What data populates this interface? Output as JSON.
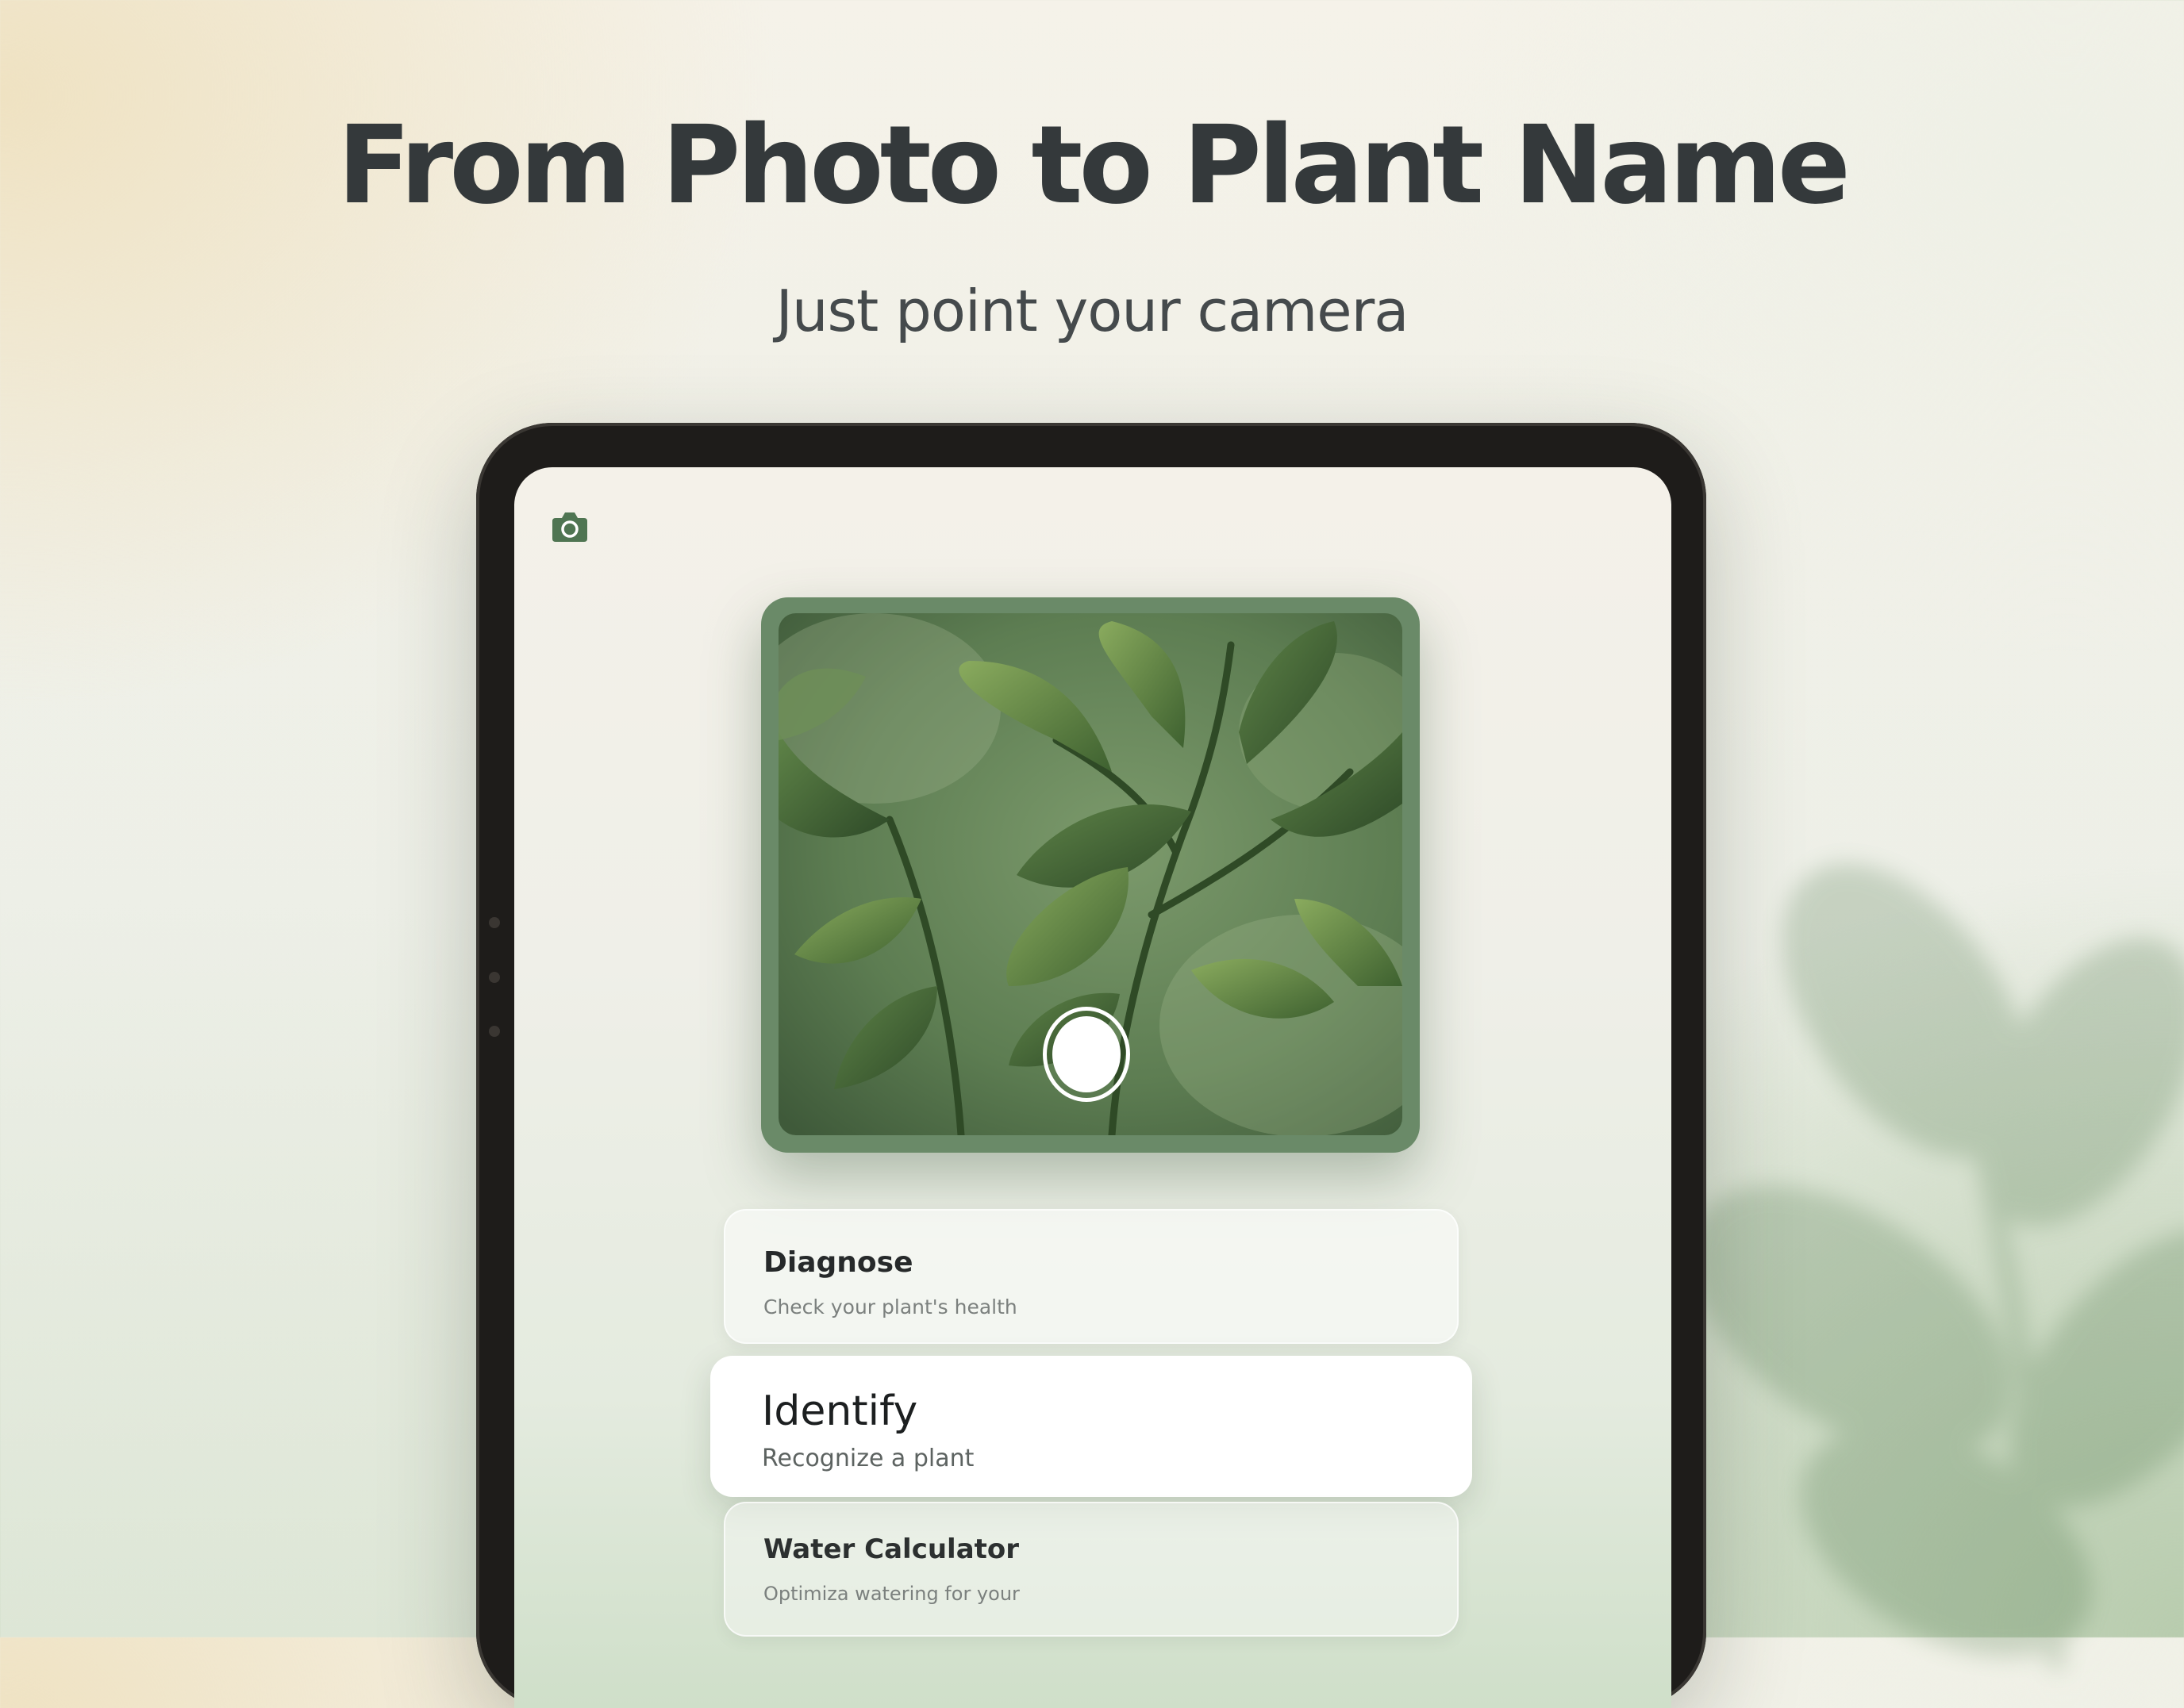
{
  "hero": {
    "title": "From Photo to Plant Name",
    "subtitle": "Just point your camera"
  },
  "app": {
    "top_icon": "camera-icon",
    "actions": [
      {
        "title": "Diagnose",
        "subtitle": "Check your plant's health"
      },
      {
        "title": "Identify",
        "subtitle": "Recognize a plant"
      },
      {
        "title": "Water Calculator",
        "subtitle": "Optimiza watering for your"
      }
    ]
  },
  "colors": {
    "accent_green": "#6a8a68",
    "title_text": "#34393b",
    "tablet_frame": "#1e1c1a"
  }
}
